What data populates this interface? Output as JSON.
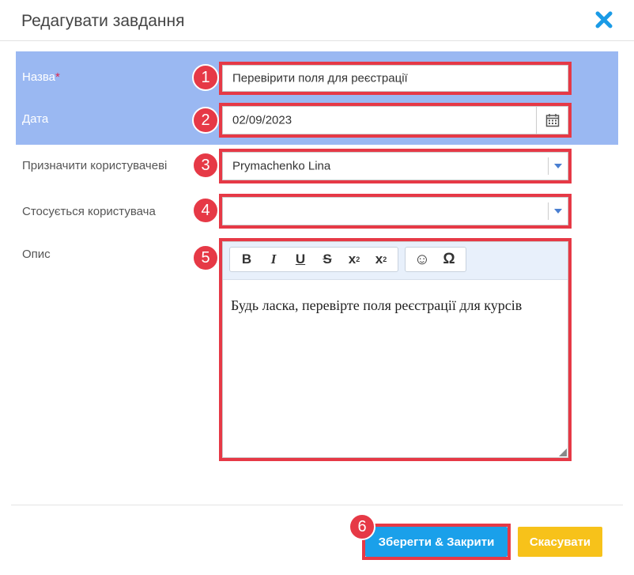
{
  "dialog": {
    "title": "Редагувати завдання"
  },
  "form": {
    "name": {
      "label": "Назва",
      "required_mark": "*",
      "value": "Перевірити поля для реєстрації"
    },
    "date": {
      "label": "Дата",
      "value": "02/09/2023"
    },
    "assign_to": {
      "label": "Призначити користувачеві",
      "value": "Prymachenko Lina"
    },
    "related_user": {
      "label": "Стосується користувача",
      "value": ""
    },
    "description": {
      "label": "Опис",
      "content": "Будь ласка, перевірте поля реєстрації для курсів",
      "toolbar": {
        "bold": "B",
        "italic": "I",
        "underline": "U",
        "strikethrough": "S",
        "subscript": "x",
        "subscript_mark": "2",
        "superscript": "x",
        "superscript_mark": "2",
        "emoji": "☺",
        "special_char": "Ω"
      }
    }
  },
  "badges": [
    "1",
    "2",
    "3",
    "4",
    "5",
    "6"
  ],
  "buttons": {
    "save": "Зберегти & Закрити",
    "cancel": "Скасувати"
  },
  "colors": {
    "highlight_band": "#9ab8f2",
    "annotation_red": "#e63946",
    "save_button": "#1aa0ea",
    "cancel_button": "#f7c21a",
    "close_icon": "#1a9be6"
  }
}
